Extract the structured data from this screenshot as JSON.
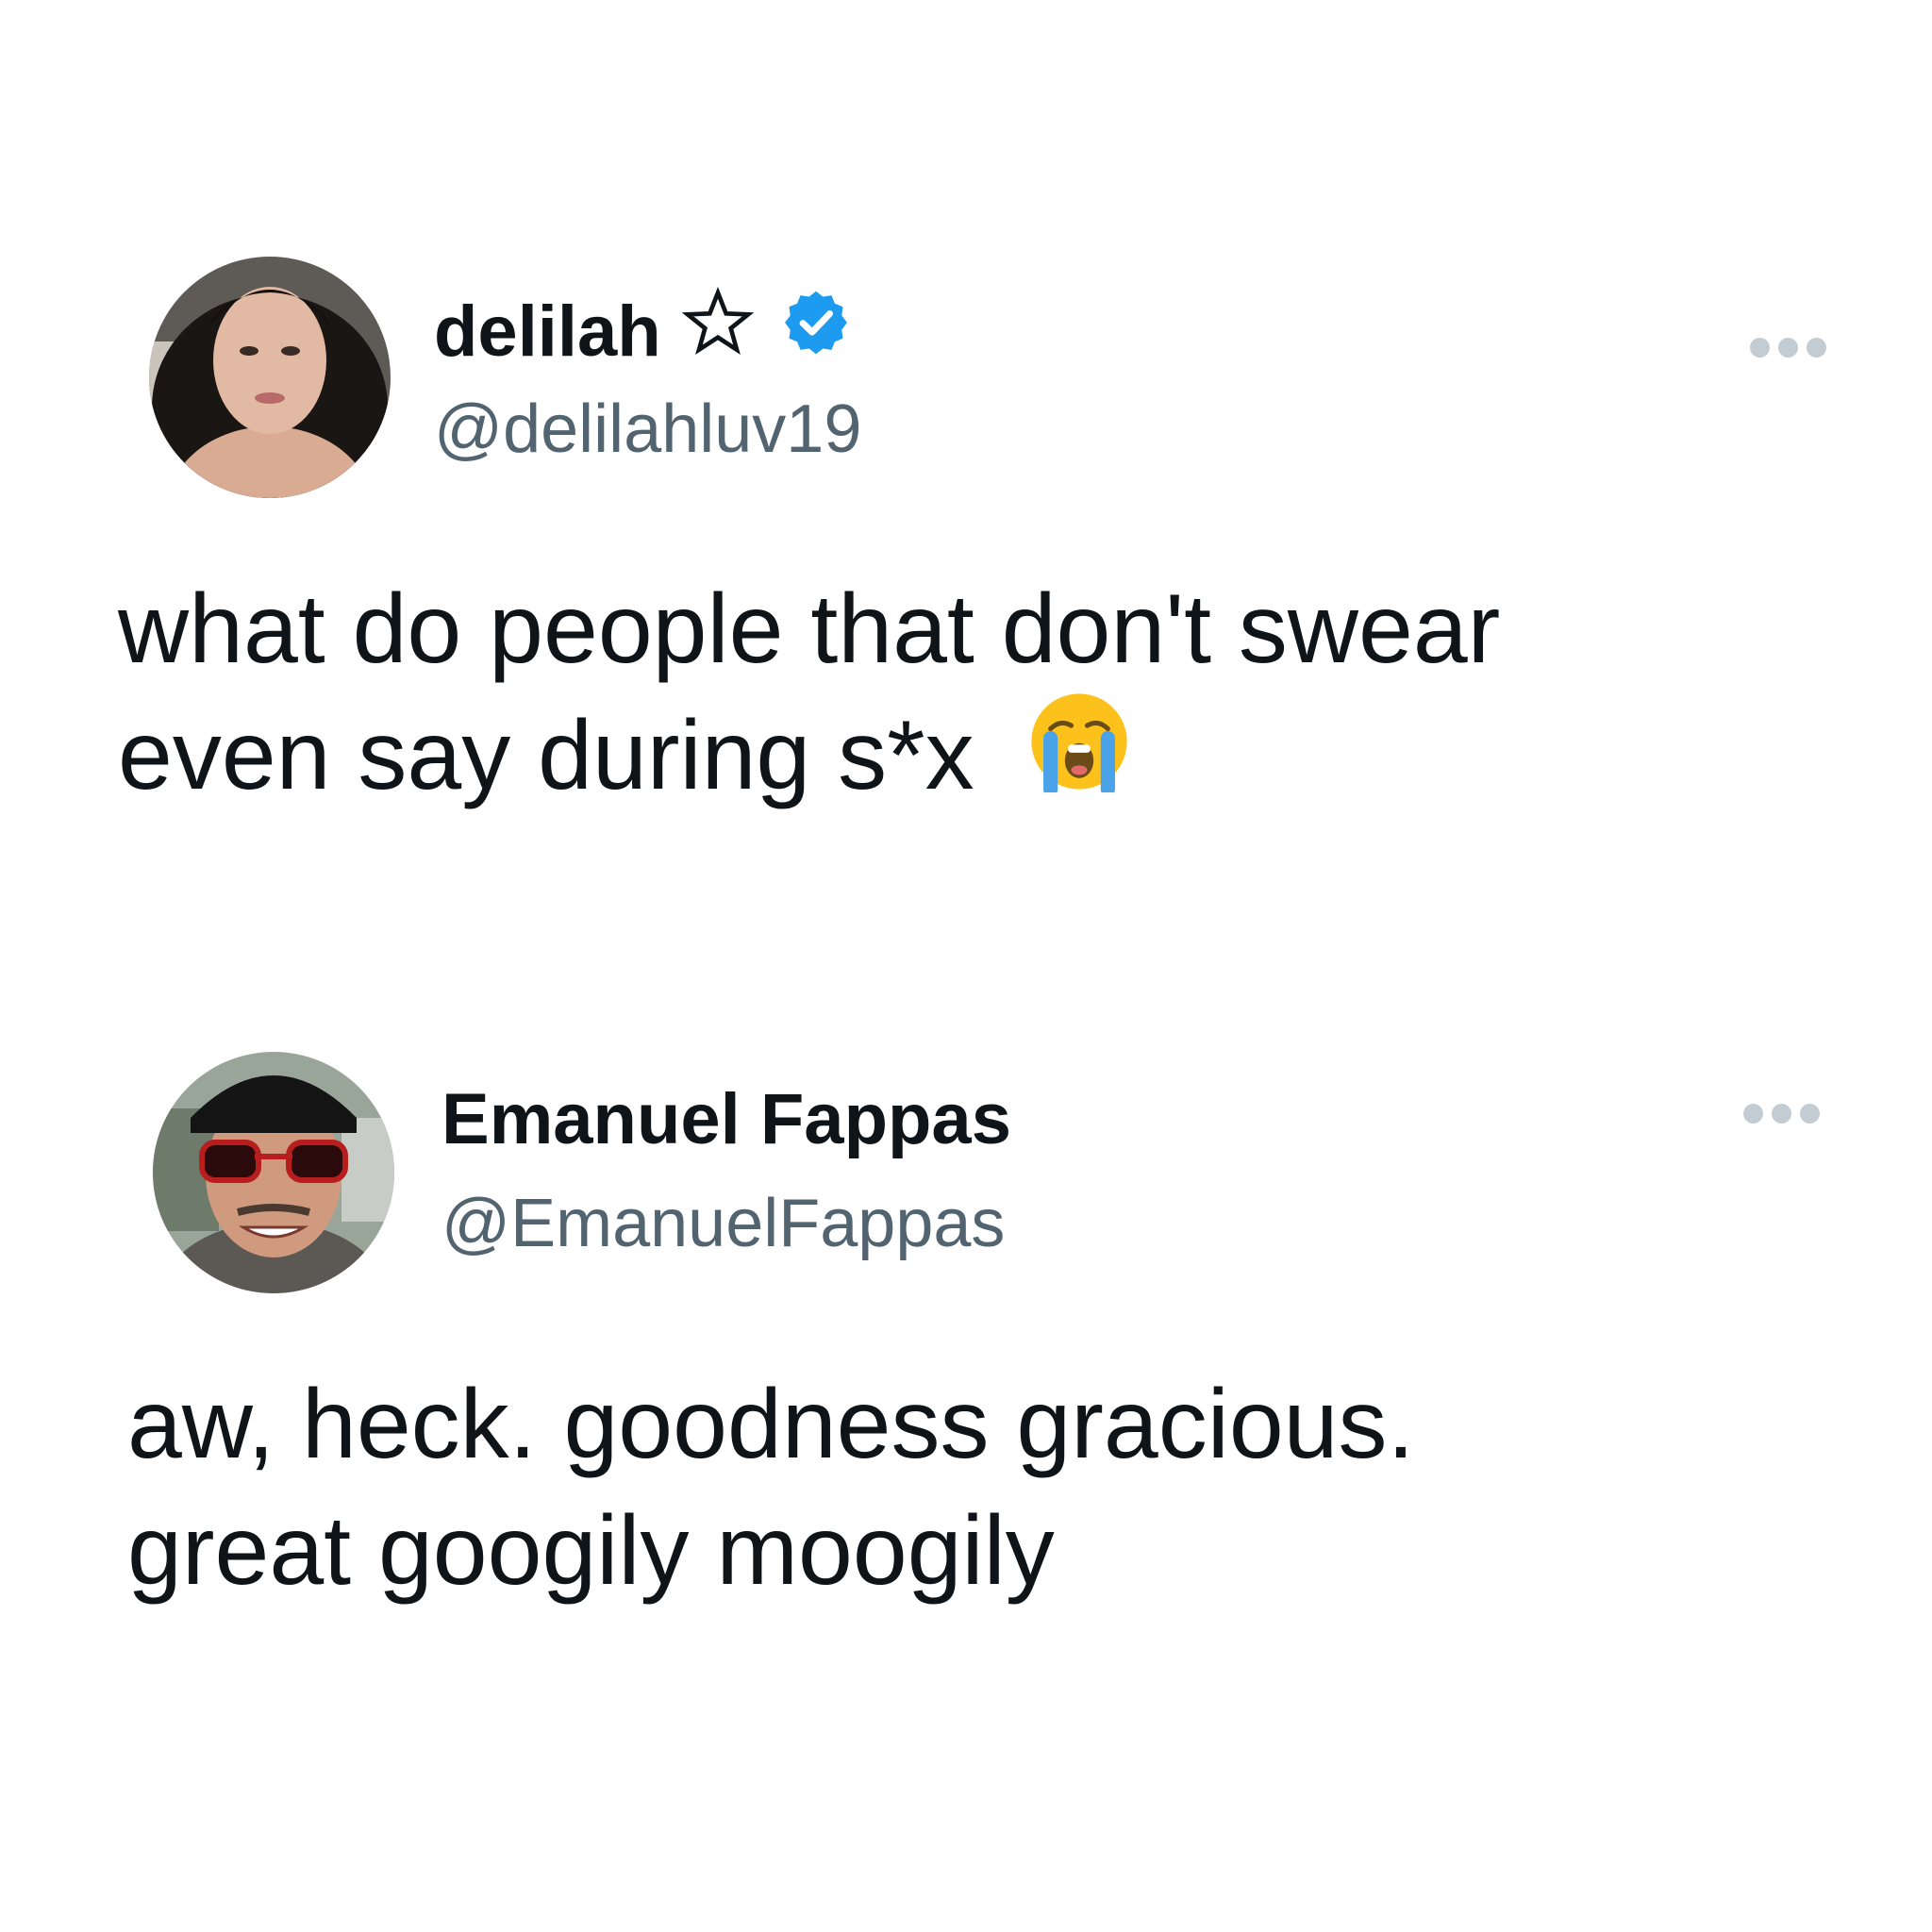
{
  "tweets": [
    {
      "display_name": "delilah",
      "handle": "@delilahluv19",
      "name_icons": [
        "star-outline-icon",
        "verified-badge-icon"
      ],
      "verified_color": "#1d9bf0",
      "text_lines": [
        "what do people that don't swear",
        "even say during s*x"
      ],
      "trailing_emoji": "loudly-crying-face-emoji"
    },
    {
      "display_name": "Emanuel Fappas",
      "handle": "@EmanuelFappas",
      "text_lines": [
        "aw, heck. goodness gracious.",
        "great googily moogily"
      ]
    }
  ],
  "colors": {
    "text": "#0f1419",
    "handle": "#536471",
    "more_dots": "#c3cbd3"
  }
}
